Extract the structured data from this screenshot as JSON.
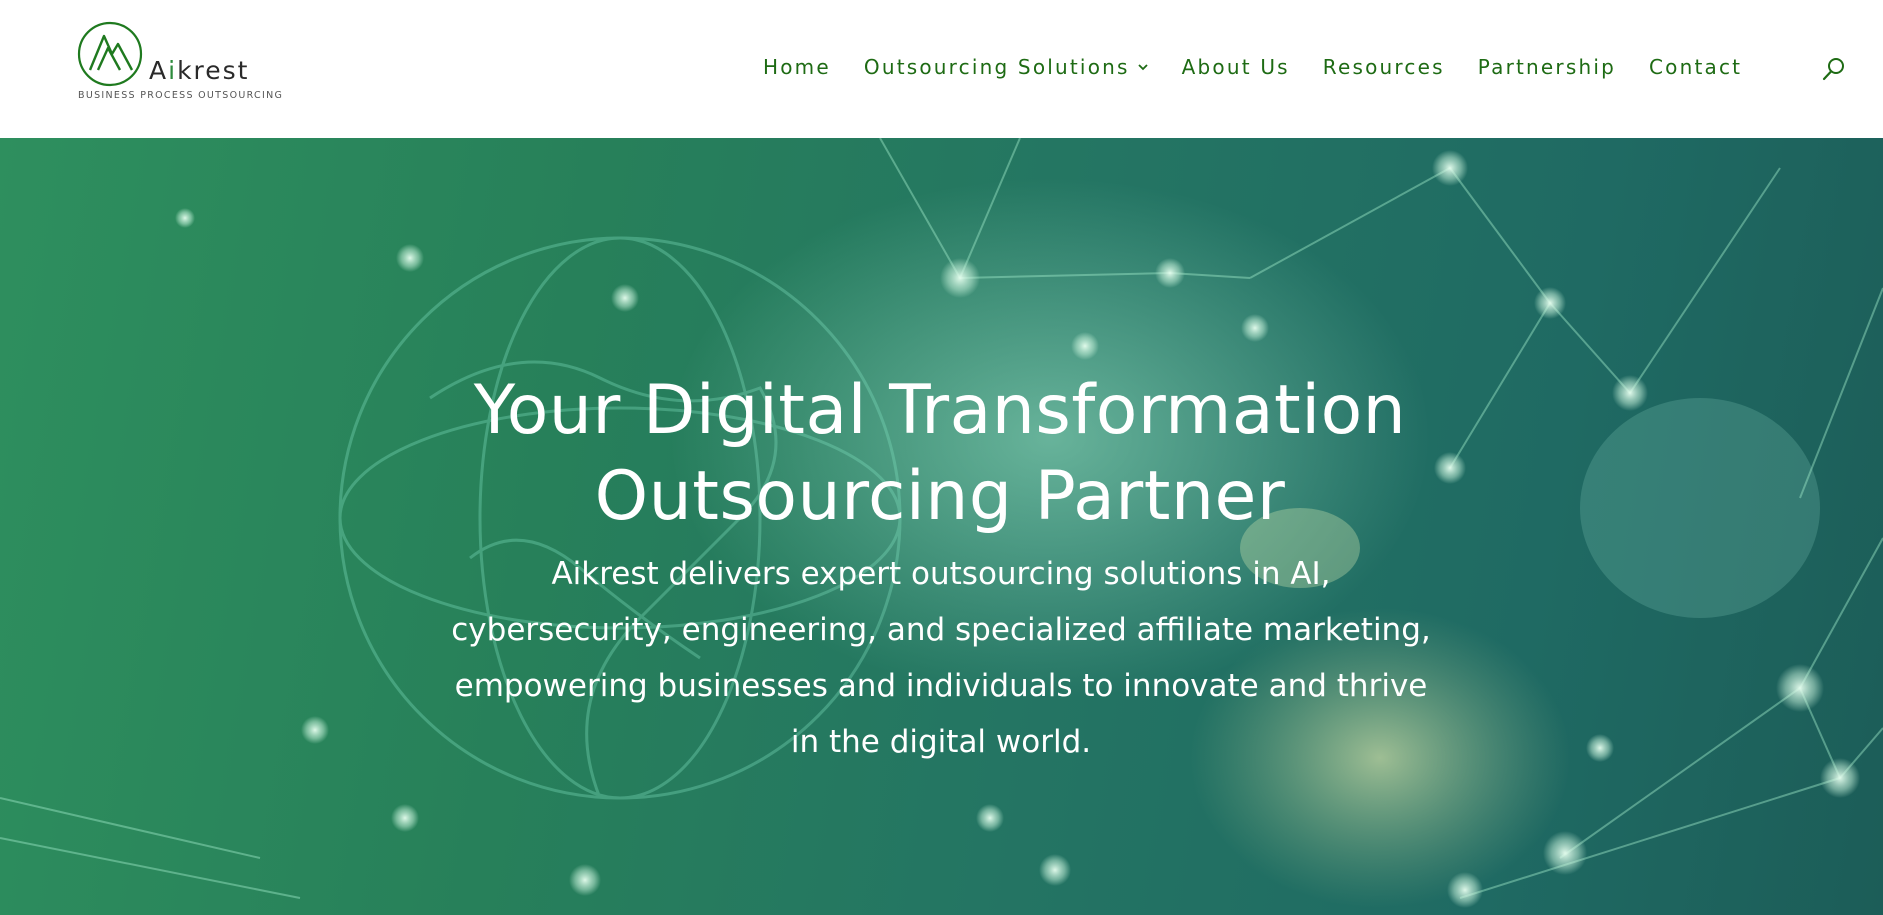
{
  "header": {
    "logo": {
      "name_prefix": "A",
      "name_accent": "i",
      "name_suffix": "krest",
      "tagline": "BUSINESS PROCESS OUTSOURCING",
      "icon": "mountain-peaks-circle-icon"
    },
    "nav": {
      "items": [
        {
          "label": "Home"
        },
        {
          "label": "Outsourcing Solutions",
          "has_dropdown": true,
          "icon": "chevron-down-icon"
        },
        {
          "label": "About Us"
        },
        {
          "label": "Resources"
        },
        {
          "label": "Partnership"
        },
        {
          "label": "Contact"
        }
      ],
      "search_icon": "search-icon"
    }
  },
  "hero": {
    "title_line1": "Your Digital Transformation",
    "title_line2": "Outsourcing Partner",
    "subtitle": "Aikrest delivers expert outsourcing solutions in AI, cybersecurity, engineering, and specialized affiliate marketing, empowering businesses and individuals to innovate and thrive in the digital world."
  },
  "colors": {
    "nav_text": "#1e6b14",
    "brand_green": "#2e8b3d",
    "hero_overlay": "#27805a",
    "hero_text": "#ffffff"
  }
}
